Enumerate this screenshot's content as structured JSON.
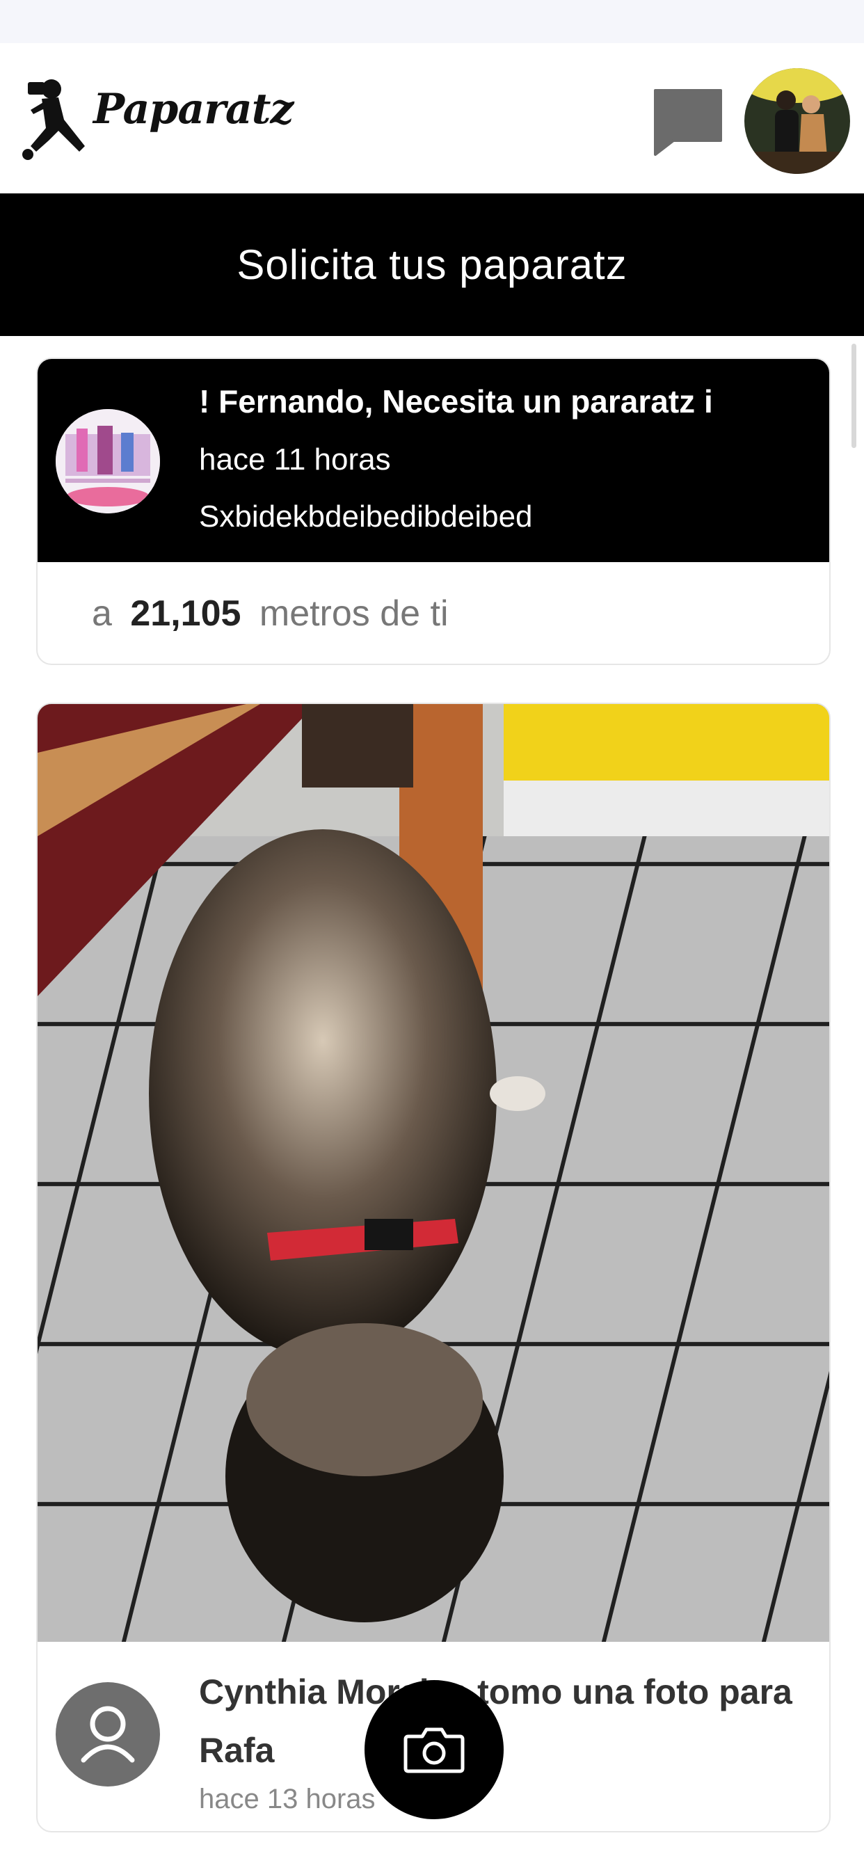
{
  "app": {
    "name": "Paparatz"
  },
  "header": {
    "logo_icon": "photographer-icon",
    "messages_icon": "chat-bubble-icon",
    "profile_avatar": "user-avatar"
  },
  "banner": {
    "label": "Solicita tus paparatz"
  },
  "request_card": {
    "avatar_icon": "requester-avatar",
    "title": "! Fernando, Necesita un pararatz i",
    "time": "hace 11 horas",
    "description": "Sxbidekbdeibedibdeibed",
    "distance_prefix": "a",
    "distance_value": "21,105",
    "distance_suffix": "metros de ti"
  },
  "post_card": {
    "photo": "dog-photo",
    "avatar_icon": "person-icon",
    "text": "Cynthia Morales tomo una foto para Rafa",
    "time": "hace 13 horas"
  },
  "fab": {
    "icon": "camera-icon"
  },
  "colors": {
    "primary": "#000000",
    "background": "#ffffff",
    "muted": "#777777"
  }
}
